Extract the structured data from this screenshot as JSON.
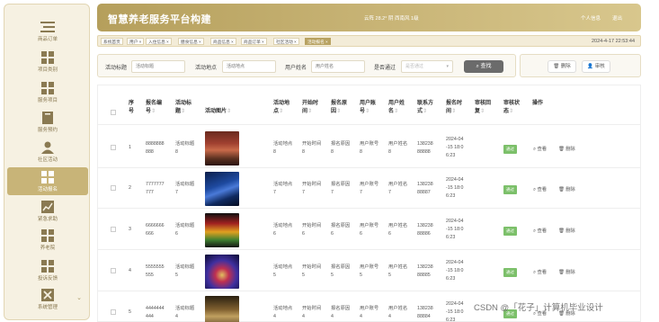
{
  "app": {
    "title": "智慧养老服务平台构建",
    "weather": "云阵 28.2° 阴 西南风 1级",
    "personal": "个人信息",
    "logout": "退出"
  },
  "sidebar": {
    "items": [
      {
        "label": "商品订单",
        "icon": "list-icon"
      },
      {
        "label": "项目类别",
        "icon": "grid-icon"
      },
      {
        "label": "服务项目",
        "icon": "grid-icon"
      },
      {
        "label": "服务预约",
        "icon": "book-icon"
      },
      {
        "label": "社区活动",
        "icon": "user-icon"
      },
      {
        "label": "活动报名",
        "icon": "grid-icon"
      },
      {
        "label": "紧急求助",
        "icon": "chart-icon"
      },
      {
        "label": "养老院",
        "icon": "grid-icon"
      },
      {
        "label": "投诉反馈",
        "icon": "grid-icon"
      },
      {
        "label": "系统管理",
        "icon": "close-icon"
      }
    ]
  },
  "tabs": [
    {
      "label": "系统首页"
    },
    {
      "label": "用户 ×"
    },
    {
      "label": "入住信息 ×"
    },
    {
      "label": "膳食信息 ×"
    },
    {
      "label": "商品信息 ×"
    },
    {
      "label": "商品订单 ×"
    },
    {
      "label": "社区活动 ×"
    },
    {
      "label": "活动报名 ×"
    }
  ],
  "datetime": "2024-4-17 22:53:44",
  "search": {
    "title_label": "活动标题",
    "title_placeholder": "活动标题",
    "place_label": "活动地点",
    "place_placeholder": "活动地点",
    "user_label": "用户姓名",
    "user_placeholder": "用户姓名",
    "pass_label": "是否通过",
    "pass_placeholder": "是否通过",
    "button": "查找"
  },
  "actions": {
    "delete": "删除",
    "review": "审核"
  },
  "table": {
    "headers": [
      "序\n号",
      "报名编\n号",
      "活动标\n题",
      "活动图片",
      "活动地\n点",
      "开始时\n间",
      "报名原\n因",
      "用户账\n号",
      "用户姓\n名",
      "联系方\n式",
      "报名时\n间",
      "审核回\n复",
      "审核状\n态",
      "操作"
    ],
    "sort_mark": "⇕",
    "view_label": "查看",
    "delete_label": "删除",
    "rows": [
      {
        "no": "1",
        "code": "8888888\n888",
        "title": "活动标题\n8",
        "place": "活动地点\n8",
        "start": "开始时间\n8",
        "reason": "报名原因\n8",
        "account": "用户账号\n8",
        "name": "用户姓名\n8",
        "phone": "138238\n88888",
        "time": "2024-04\n-15 18:0\n6:23",
        "status": "通过"
      },
      {
        "no": "2",
        "code": "7777777\n777",
        "title": "活动标题\n7",
        "place": "活动地点\n7",
        "start": "开始时间\n7",
        "reason": "报名原因\n7",
        "account": "用户账号\n7",
        "name": "用户姓名\n7",
        "phone": "138238\n88887",
        "time": "2024-04\n-15 18:0\n6:23",
        "status": "通过"
      },
      {
        "no": "3",
        "code": "6666666\n666",
        "title": "活动标题\n6",
        "place": "活动地点\n6",
        "start": "开始时间\n6",
        "reason": "报名原因\n6",
        "account": "用户账号\n6",
        "name": "用户姓名\n6",
        "phone": "138238\n88886",
        "time": "2024-04\n-15 18:0\n6:23",
        "status": "通过"
      },
      {
        "no": "4",
        "code": "5555555\n555",
        "title": "活动标题\n5",
        "place": "活动地点\n5",
        "start": "开始时间\n5",
        "reason": "报名原因\n5",
        "account": "用户账号\n5",
        "name": "用户姓名\n5",
        "phone": "138238\n88885",
        "time": "2024-04\n-15 18:0\n6:23",
        "status": "通过"
      },
      {
        "no": "5",
        "code": "4444444\n444",
        "title": "活动标题\n4",
        "place": "活动地点\n4",
        "start": "开始时间\n4",
        "reason": "报名原因\n4",
        "account": "用户账号\n4",
        "name": "用户姓名\n4",
        "phone": "138238\n88884",
        "time": "2024-04\n-15 18:0\n6:23",
        "status": "通过"
      }
    ]
  },
  "watermark": "CSDN @「花子」计算机毕业设计",
  "colors": {
    "accent": "#c8b478",
    "header": "#b59f5c",
    "approved": "#7cc06a",
    "search_button": "#6b6b6b"
  }
}
